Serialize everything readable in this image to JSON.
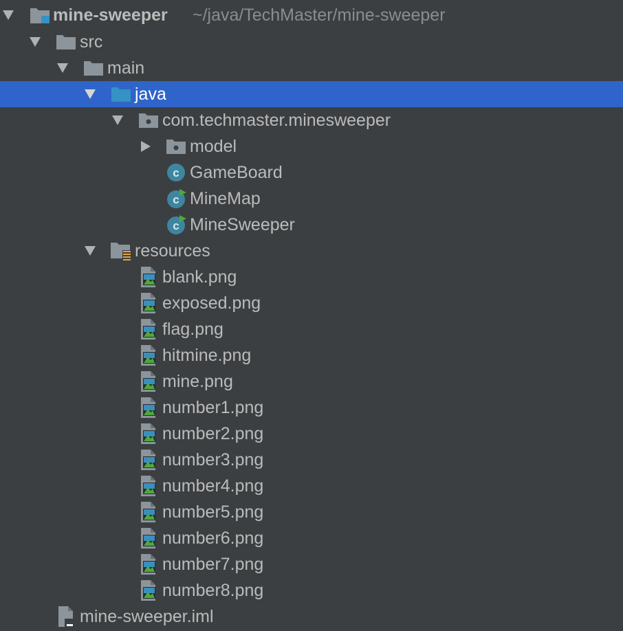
{
  "project_tree": {
    "root": {
      "label": "mine-sweeper",
      "path": "~/java/TechMaster/mine-sweeper"
    },
    "src": {
      "label": "src"
    },
    "main": {
      "label": "main"
    },
    "java": {
      "label": "java"
    },
    "package": {
      "label": "com.techmaster.minesweeper"
    },
    "model": {
      "label": "model"
    },
    "classes": [
      {
        "label": "GameBoard",
        "icon": "class-icon"
      },
      {
        "label": "MineMap",
        "icon": "runnable-class-icon"
      },
      {
        "label": "MineSweeper",
        "icon": "runnable-class-icon"
      }
    ],
    "resources": {
      "label": "resources"
    },
    "files": [
      "blank.png",
      "exposed.png",
      "flag.png",
      "hitmine.png",
      "mine.png",
      "number1.png",
      "number2.png",
      "number3.png",
      "number4.png",
      "number5.png",
      "number6.png",
      "number7.png",
      "number8.png"
    ],
    "iml": {
      "label": "mine-sweeper.iml"
    }
  },
  "colors": {
    "background": "#3c3f41",
    "selection": "#2f65ca",
    "text": "#bbbbbb",
    "path_text": "#8c8c8c",
    "folder": "#8c959c",
    "source_folder": "#3592c4",
    "class_badge": "#3e86a0",
    "run_badge": "#4fa93a"
  }
}
